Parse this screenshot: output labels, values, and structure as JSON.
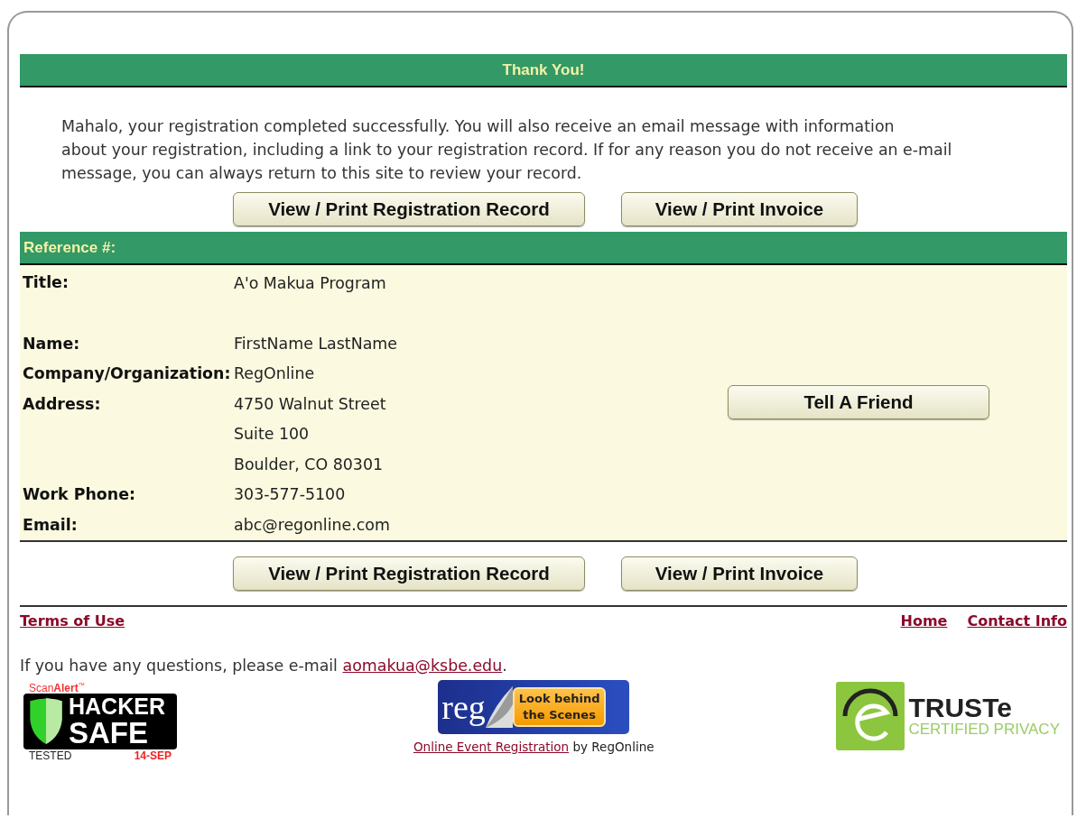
{
  "header": {
    "title": "Thank You!"
  },
  "message": {
    "lines": [
      "Mahalo, your registration completed successfully. You will also receive an email message with information",
      "about your registration, including a link to your registration record.  If for any reason you do not receive an e-mail",
      "message, you can always return to this site to review your record."
    ]
  },
  "top_buttons": [
    "View / Print Registration Record",
    "View / Print Invoice"
  ],
  "reference": {
    "title": "Reference #:"
  },
  "event": {
    "label": "Title:",
    "values": [
      "A'o Makua Program"
    ]
  },
  "details": [
    {
      "label": "Name:",
      "values": [
        "FirstName LastName"
      ]
    },
    {
      "label": "Company/Organization:",
      "values": [
        "RegOnline"
      ]
    },
    {
      "label": "Address:",
      "values": [
        "4750 Walnut Street",
        "Suite 100",
        "Boulder, CO 80301"
      ],
      "action": "Tell A Friend"
    },
    {
      "label": "Work Phone:",
      "values": [
        "303-577-5100"
      ]
    },
    {
      "label": "Email:",
      "values": [
        "abc@regonline.com"
      ]
    }
  ],
  "bottom_buttons": [
    "View / Print Registration Record",
    "View / Print Invoice"
  ],
  "footer_links": {
    "left": [
      "Terms of Use"
    ],
    "right": [
      "Home",
      "Contact Info"
    ]
  },
  "contact": {
    "text": "If you have any questions, please e-mail ",
    "email": "aomakua@ksbe.edu",
    "end": "."
  },
  "badges": {
    "hacker_safe": {
      "brand": "Scan",
      "brand_bold": "Alert",
      "trademark": "™",
      "line1": "HACKER",
      "line2": "SAFE",
      "tested": "TESTED",
      "date": "14-SEP"
    },
    "regonline": {
      "logo": "reg",
      "tab_line1": "Look behind",
      "tab_line2": "the Scenes",
      "link": "Online Event Registration",
      "by": "by RegOnline"
    },
    "truste": {
      "name": "TRUSTe",
      "tagline": "CERTIFIED PRIVACY"
    }
  }
}
